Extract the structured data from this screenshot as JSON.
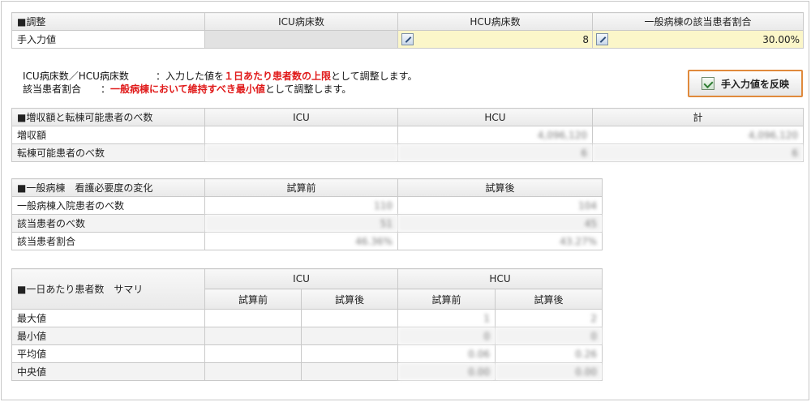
{
  "adjust": {
    "header": [
      "■調整",
      "ICU病床数",
      "HCU病床数",
      "一般病棟の該当患者割合"
    ],
    "row_label": "手入力値",
    "hcu_value": "8",
    "ratio_value": "30.00%"
  },
  "notes": {
    "line1_key": "ICU病床数／HCU病床数",
    "line1_sep": "：入力した値を",
    "line1_red": "１日あたり患者数の上限",
    "line1_tail": "として調整します。",
    "line2_key": "該当患者割合",
    "line2_sep": "：",
    "line2_red": "一般病棟において維持すべき最小値",
    "line2_tail": "として調整します。"
  },
  "apply_button": {
    "label": "手入力値を反映",
    "icon": "check-icon"
  },
  "gain": {
    "header": [
      "■増収額と転棟可能患者のべ数",
      "ICU",
      "HCU",
      "計"
    ],
    "rows": [
      {
        "label": "増収額",
        "icu": "",
        "hcu": "4,096,120",
        "total": "4,096,120"
      },
      {
        "label": "転棟可能患者のべ数",
        "icu": "",
        "hcu": "6",
        "total": "6"
      }
    ]
  },
  "nurse": {
    "header": [
      "■一般病棟　看護必要度の変化",
      "試算前",
      "試算後"
    ],
    "rows": [
      {
        "label": "一般病棟入院患者のべ数",
        "before": "110",
        "after": "104"
      },
      {
        "label": "該当患者のべ数",
        "before": "51",
        "after": "45"
      },
      {
        "label": "該当患者割合",
        "before": "46.36%",
        "after": "43.27%"
      }
    ]
  },
  "summary": {
    "corner": "■一日あたり患者数　サマリ",
    "groups": [
      "ICU",
      "HCU"
    ],
    "subs": [
      "試算前",
      "試算後",
      "試算前",
      "試算後"
    ],
    "rows": [
      {
        "label": "最大値",
        "icu_before": "",
        "icu_after": "",
        "hcu_before": "1",
        "hcu_after": "2"
      },
      {
        "label": "最小値",
        "icu_before": "",
        "icu_after": "",
        "hcu_before": "0",
        "hcu_after": "0"
      },
      {
        "label": "平均値",
        "icu_before": "",
        "icu_after": "",
        "hcu_before": "0.06",
        "hcu_after": "0.26"
      },
      {
        "label": "中央値",
        "icu_before": "",
        "icu_after": "",
        "hcu_before": "0.00",
        "hcu_after": "0.00"
      }
    ]
  }
}
